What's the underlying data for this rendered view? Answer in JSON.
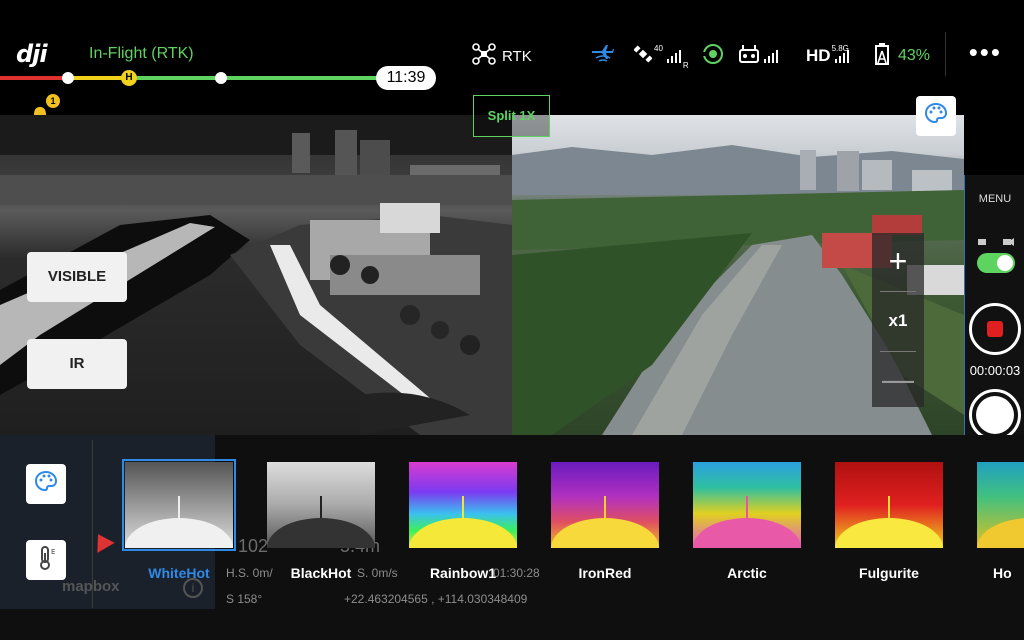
{
  "header": {
    "logo_text": "dji",
    "flight_status": "In-Flight (RTK)",
    "rtk_label": "RTK",
    "gps_count": "40",
    "gps_suffix": "R",
    "hd_label": "HD",
    "hd_band": "5.8G",
    "battery_percent": "43%",
    "more_menu": "•••",
    "flight_time": "11:39",
    "home_marker": "H",
    "notification_count": "1",
    "accent_color": "#5fd35f"
  },
  "view": {
    "split_label": "Split 1X",
    "visible_button": "VISIBLE",
    "ir_button": "IR"
  },
  "zoom": {
    "plus": "+",
    "level": "x1",
    "minus": "—"
  },
  "camera": {
    "menu_label": "MENU",
    "record_time": "00:00:03",
    "record_color": "#e02020"
  },
  "telemetry": {
    "distance": "102",
    "height": "5.4m",
    "hs": "H.S. 0m/",
    "vs": "S. 0m/s",
    "time": "01:30:28",
    "heading": "S   158°",
    "coords": "+22.463204565 , +114.030348409",
    "map_attribution": "mapbox",
    "info": "i"
  },
  "palettes": [
    {
      "label": "WhiteHot",
      "selected": true
    },
    {
      "label": "BlackHot",
      "selected": false
    },
    {
      "label": "Rainbow1",
      "selected": false
    },
    {
      "label": "IronRed",
      "selected": false
    },
    {
      "label": "Arctic",
      "selected": false
    },
    {
      "label": "Fulgurite",
      "selected": false
    },
    {
      "label": "Ho",
      "selected": false
    }
  ]
}
